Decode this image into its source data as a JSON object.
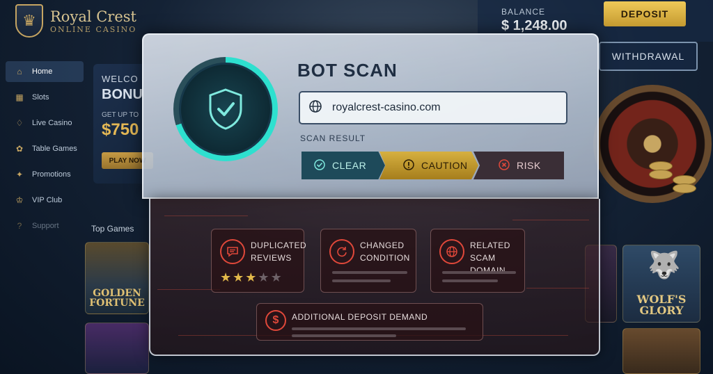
{
  "brand": {
    "name": "Royal Crest",
    "tagline": "ONLINE CASINO"
  },
  "sidebar": {
    "items": [
      {
        "label": "Home",
        "icon": "home-icon"
      },
      {
        "label": "Slots",
        "icon": "slots-icon"
      },
      {
        "label": "Live Casino",
        "icon": "live-casino-icon"
      },
      {
        "label": "Table Games",
        "icon": "table-games-icon"
      },
      {
        "label": "Promotions",
        "icon": "promotions-icon"
      },
      {
        "label": "VIP Club",
        "icon": "vip-icon"
      },
      {
        "label": "Support",
        "icon": "support-icon"
      }
    ]
  },
  "promo": {
    "welcome": "WELCO",
    "bonus": "BONU",
    "get_up": "GET UP TO",
    "amount": "$750",
    "play": "PLAY NOW"
  },
  "top_games": {
    "label": "Top Games",
    "games": [
      "GOLDEN FORTUNE",
      "WOLF'S GLORY"
    ]
  },
  "account": {
    "balance_label": "BALANCE",
    "balance_value": "$ 1,248.00",
    "deposit": "DEPOSIT",
    "withdrawal": "WITHDRAWAL"
  },
  "scan": {
    "title": "BOT SCAN",
    "url": "royalcrest-casino.com",
    "result_label": "SCAN RESULT",
    "segments": {
      "clear": "CLEAR",
      "caution": "CAUTION",
      "risk": "RISK"
    },
    "selected": "CAUTION",
    "flags": {
      "reviews": {
        "line1": "DUPLICATED",
        "line2": "REVIEWS",
        "rating": 3,
        "max": 5
      },
      "condition": {
        "line1": "CHANGED",
        "line2": "CONDITION"
      },
      "domain": {
        "line1": "RELATED",
        "line2": "SCAM DOMAIN"
      },
      "deposit": {
        "line1": "ADDITIONAL DEPOSIT DEMAND"
      }
    }
  },
  "colors": {
    "accent_teal": "#2ee0cf",
    "caution_gold": "#d6b040",
    "risk_red": "#e0483a",
    "brand_gold": "#c9a55a"
  }
}
